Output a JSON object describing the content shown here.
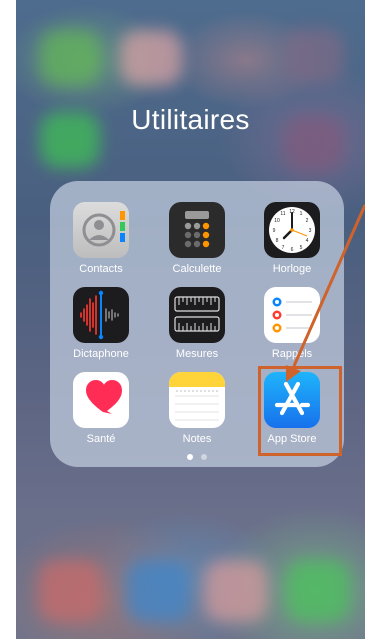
{
  "folder": {
    "title": "Utilitaires",
    "apps": [
      {
        "label": "Contacts",
        "icon": "contacts-icon"
      },
      {
        "label": "Calculette",
        "icon": "calculator-icon"
      },
      {
        "label": "Horloge",
        "icon": "clock-icon"
      },
      {
        "label": "Dictaphone",
        "icon": "voice-memo-icon"
      },
      {
        "label": "Mesures",
        "icon": "measure-icon"
      },
      {
        "label": "Rappels",
        "icon": "reminders-icon"
      },
      {
        "label": "Santé",
        "icon": "health-icon"
      },
      {
        "label": "Notes",
        "icon": "notes-icon"
      },
      {
        "label": "App Store",
        "icon": "app-store-icon"
      }
    ],
    "page_dots": {
      "count": 2,
      "active": 1
    }
  },
  "colors": {
    "annotation": "#d0622c",
    "app_store_blue": "#1d8cf3",
    "health_red": "#ff2d55",
    "notes_yellow": "#ffd43b"
  }
}
